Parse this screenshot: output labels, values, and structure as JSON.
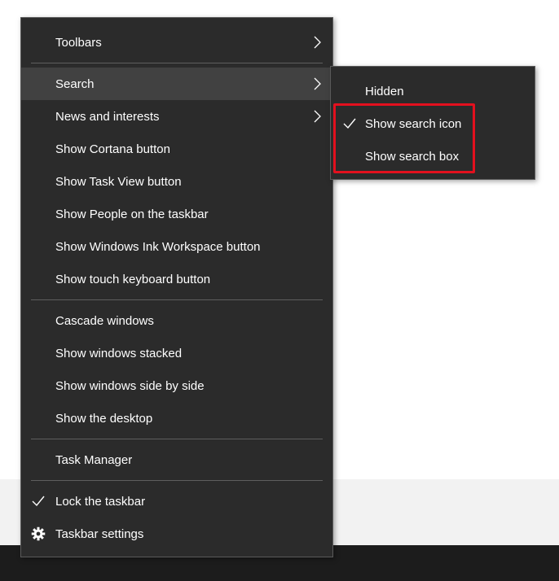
{
  "context_menu": {
    "items": [
      {
        "label": "Toolbars"
      },
      {
        "label": "Search"
      },
      {
        "label": "News and interests"
      },
      {
        "label": "Show Cortana button"
      },
      {
        "label": "Show Task View button"
      },
      {
        "label": "Show People on the taskbar"
      },
      {
        "label": "Show Windows Ink Workspace button"
      },
      {
        "label": "Show touch keyboard button"
      },
      {
        "label": "Cascade windows"
      },
      {
        "label": "Show windows stacked"
      },
      {
        "label": "Show windows side by side"
      },
      {
        "label": "Show the desktop"
      },
      {
        "label": "Task Manager"
      },
      {
        "label": "Lock the taskbar",
        "checked": true
      },
      {
        "label": "Taskbar settings",
        "icon": "gear-icon"
      }
    ]
  },
  "search_submenu": {
    "items": [
      {
        "label": "Hidden",
        "checked": false
      },
      {
        "label": "Show search icon",
        "checked": true
      },
      {
        "label": "Show search box",
        "checked": false
      }
    ]
  },
  "colors": {
    "menu_background": "#2b2b2b",
    "hover_background": "#414141",
    "highlight_border": "#e3101e",
    "taskbar": "#1c1c1c"
  }
}
